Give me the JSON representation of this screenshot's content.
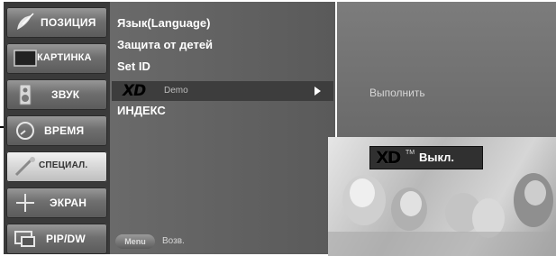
{
  "categories": [
    {
      "label": "ПОЗИЦИЯ",
      "icon": "satellite-dish-icon",
      "active": false
    },
    {
      "label": "КАРТИНКА",
      "icon": "monitor-icon",
      "active": false
    },
    {
      "label": "ЗВУК",
      "icon": "speaker-icon",
      "active": false
    },
    {
      "label": "ВРЕМЯ",
      "icon": "clock-icon",
      "active": false
    },
    {
      "label": "СПЕЦИАЛ.",
      "icon": "wand-icon",
      "active": true
    },
    {
      "label": "ЭКРАН",
      "icon": "cross-move-icon",
      "active": false
    },
    {
      "label": "PIP/DW",
      "icon": "pip-icon",
      "active": false
    }
  ],
  "submenu": {
    "items": [
      "Язык(Language)",
      "Защита от детей",
      "Set ID"
    ],
    "xd_logo": "XD",
    "xd_demo_label": "Demo",
    "index_label": "ИНДЕКС",
    "menu_key": "Menu",
    "return_label": "Возв."
  },
  "right_panel": {
    "execute_label": "Выполнить"
  },
  "preview": {
    "banner_logo": "XD",
    "banner_tm": "TM",
    "banner_state": "Выкл."
  }
}
